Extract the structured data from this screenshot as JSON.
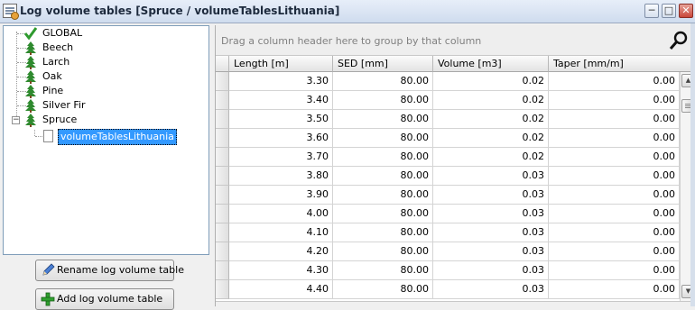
{
  "window": {
    "title": "Log volume tables [Spruce  / volumeTablesLithuania]",
    "icon": "log-table-app-icon",
    "controls": [
      "minimize",
      "maximize",
      "close"
    ]
  },
  "tree": {
    "nodes": [
      {
        "label": "GLOBAL",
        "icon": "green-check-icon"
      },
      {
        "label": "Beech",
        "icon": "tree-icon"
      },
      {
        "label": "Larch",
        "icon": "tree-icon"
      },
      {
        "label": "Oak",
        "icon": "tree-icon"
      },
      {
        "label": "Pine",
        "icon": "tree-icon"
      },
      {
        "label": "Silver Fir",
        "icon": "tree-icon"
      },
      {
        "label": "Spruce",
        "icon": "tree-icon",
        "expanded": true,
        "children": [
          {
            "label": "volumeTablesLithuania",
            "icon": "document-icon",
            "selected": true
          }
        ]
      }
    ]
  },
  "buttons": {
    "rename": {
      "label": "Rename log volume table",
      "icon": "pencil-icon"
    },
    "add": {
      "label": "Add log volume table",
      "icon": "green-plus-icon"
    }
  },
  "grid": {
    "group_panel_text": "Drag a column header here to group by that column",
    "search_icon": "magnifier-icon",
    "columns": [
      "Length [m]",
      "SED [mm]",
      "Volume [m3]",
      "Taper [mm/m]"
    ],
    "rows": [
      [
        "3.30",
        "80.00",
        "0.02",
        "0.00"
      ],
      [
        "3.40",
        "80.00",
        "0.02",
        "0.00"
      ],
      [
        "3.50",
        "80.00",
        "0.02",
        "0.00"
      ],
      [
        "3.60",
        "80.00",
        "0.02",
        "0.00"
      ],
      [
        "3.70",
        "80.00",
        "0.02",
        "0.00"
      ],
      [
        "3.80",
        "80.00",
        "0.03",
        "0.00"
      ],
      [
        "3.90",
        "80.00",
        "0.03",
        "0.00"
      ],
      [
        "4.00",
        "80.00",
        "0.03",
        "0.00"
      ],
      [
        "4.10",
        "80.00",
        "0.03",
        "0.00"
      ],
      [
        "4.20",
        "80.00",
        "0.03",
        "0.00"
      ],
      [
        "4.30",
        "80.00",
        "0.03",
        "0.00"
      ],
      [
        "4.40",
        "80.00",
        "0.03",
        "0.00"
      ]
    ]
  },
  "colors": {
    "selection": "#3399ff",
    "tree_green": "#2f8a2f",
    "title_bar": "#cfdcee"
  }
}
